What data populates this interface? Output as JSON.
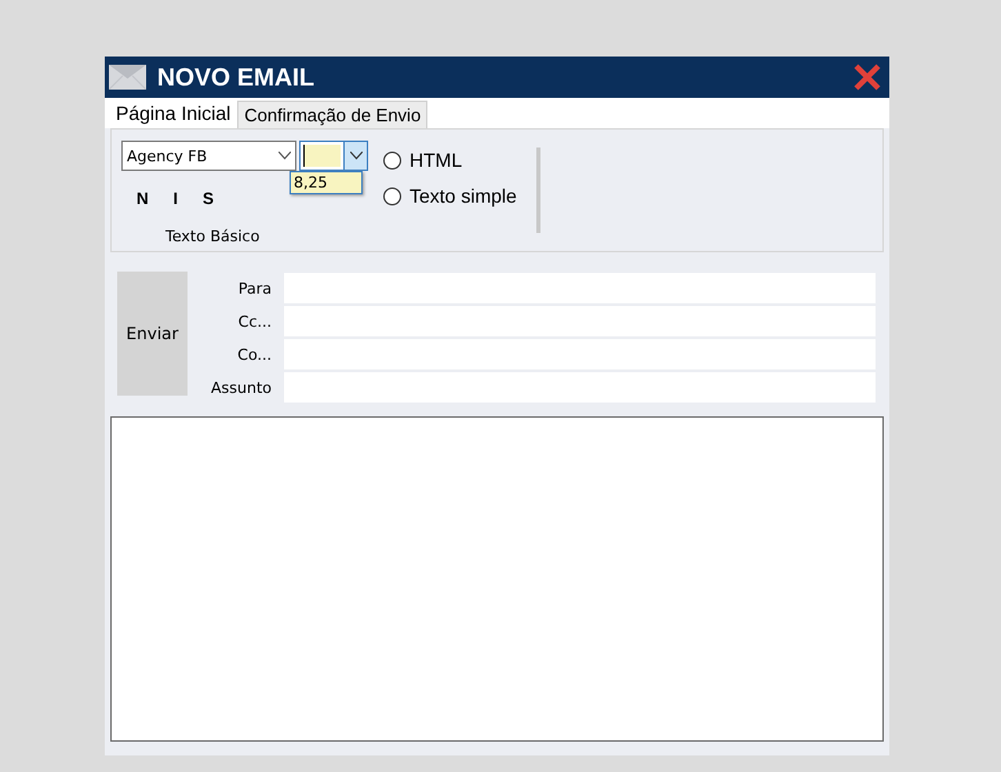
{
  "window": {
    "title": "NOVO EMAIL"
  },
  "tabs": [
    {
      "label": "Página Inicial",
      "selected": true
    },
    {
      "label": "Confirmação de Envio",
      "selected": false
    }
  ],
  "ribbon": {
    "font": {
      "value": "Agency FB"
    },
    "size": {
      "open": true,
      "options": [
        {
          "label": "8,25",
          "selected": false
        }
      ]
    },
    "format_buttons": [
      "N",
      "I",
      "S"
    ],
    "group_label": "Texto Básico",
    "formats": [
      {
        "label": "HTML",
        "selected": false
      },
      {
        "label": "Texto simple",
        "selected": false
      }
    ]
  },
  "send_button": "Enviar",
  "fields": [
    {
      "label": "Para"
    },
    {
      "label": "Cc..."
    },
    {
      "label": "Co..."
    },
    {
      "label": "Assunto"
    }
  ]
}
